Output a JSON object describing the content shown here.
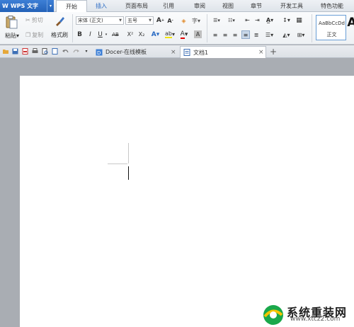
{
  "app": {
    "name": "WPS 文字",
    "menu_arrow": "▾"
  },
  "menu": {
    "tabs": [
      {
        "label": "开始"
      },
      {
        "label": "插入"
      },
      {
        "label": "页面布局"
      },
      {
        "label": "引用"
      },
      {
        "label": "审阅"
      },
      {
        "label": "视图"
      },
      {
        "label": "章节"
      },
      {
        "label": "开发工具"
      },
      {
        "label": "特色功能"
      }
    ],
    "active_tab": "开始"
  },
  "ribbon": {
    "paste_label": "粘贴",
    "cut_label": "剪切",
    "copy_label": "复制",
    "format_painter_label": "格式刷",
    "font_name": "宋体 (正文)",
    "font_size": "五号",
    "bold": "B",
    "italic": "I",
    "underline": "U",
    "strike": "AB",
    "superscript": "X²",
    "subscript": "X₂",
    "style_sample": "AaBbCcDd",
    "style_name": "正文",
    "style_big_a": "A"
  },
  "docbar": {
    "tabs": [
      {
        "label": "Docer-在线模板",
        "close": "×"
      },
      {
        "label": "文档1",
        "close": "×"
      }
    ],
    "add_tab": "+"
  },
  "watermark": {
    "title": "系统重装网",
    "url": "www.xtcz2.com"
  },
  "colors": {
    "accent": "#2a6bc4",
    "page": "#ffffff",
    "workspace": "#a9adb3"
  }
}
